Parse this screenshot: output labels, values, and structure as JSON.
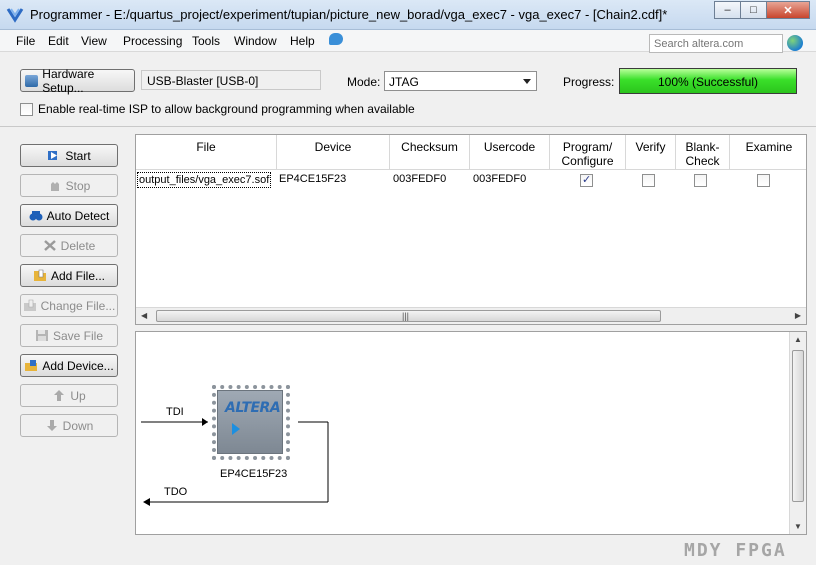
{
  "window": {
    "title": "Programmer - E:/quartus_project/experiment/tupian/picture_new_borad/vga_exec7 - vga_exec7 - [Chain2.cdf]*",
    "controls": [
      "minimize",
      "maximize",
      "close"
    ]
  },
  "menu": {
    "items": [
      {
        "label": "File"
      },
      {
        "label": "Edit"
      },
      {
        "label": "View"
      },
      {
        "label": "Processing"
      },
      {
        "label": "Tools"
      },
      {
        "label": "Window"
      },
      {
        "label": "Help"
      }
    ],
    "search_placeholder": "Search altera.com"
  },
  "hardware": {
    "setup_label": "Hardware Setup...",
    "device": "USB-Blaster [USB-0]",
    "mode_label": "Mode:",
    "mode_value": "JTAG",
    "progress_label": "Progress:",
    "progress_text": "100% (Successful)",
    "progress_percent": 100,
    "isp_label": "Enable real-time ISP to allow background programming when available",
    "isp_checked": false
  },
  "actions": [
    {
      "label": "Start",
      "enabled": true,
      "icon": "start-icon"
    },
    {
      "label": "Stop",
      "enabled": false,
      "icon": "stop-icon"
    },
    {
      "label": "Auto Detect",
      "enabled": true,
      "icon": "auto-detect-icon"
    },
    {
      "label": "Delete",
      "enabled": false,
      "icon": "delete-icon"
    },
    {
      "label": "Add File...",
      "enabled": true,
      "icon": "add-file-icon"
    },
    {
      "label": "Change File...",
      "enabled": false,
      "icon": "change-file-icon"
    },
    {
      "label": "Save File",
      "enabled": false,
      "icon": "save-file-icon"
    },
    {
      "label": "Add Device...",
      "enabled": true,
      "icon": "add-device-icon"
    },
    {
      "label": "Up",
      "enabled": false,
      "icon": "up-icon"
    },
    {
      "label": "Down",
      "enabled": false,
      "icon": "down-icon"
    }
  ],
  "table": {
    "columns": [
      "File",
      "Device",
      "Checksum",
      "Usercode",
      "Program/ Configure",
      "Verify",
      "Blank- Check",
      "Examine"
    ],
    "rows": [
      {
        "file": "output_files/vga_exec7.sof",
        "device": "EP4CE15F23",
        "checksum": "003FEDF0",
        "usercode": "003FEDF0",
        "program": true,
        "verify": false,
        "blank_check": false,
        "examine": false
      }
    ]
  },
  "chain": {
    "tdi": "TDI",
    "tdo": "TDO",
    "chip_logo": "ALTERA",
    "chip_name": "EP4CE15F23"
  },
  "watermark": "MDY FPGA"
}
